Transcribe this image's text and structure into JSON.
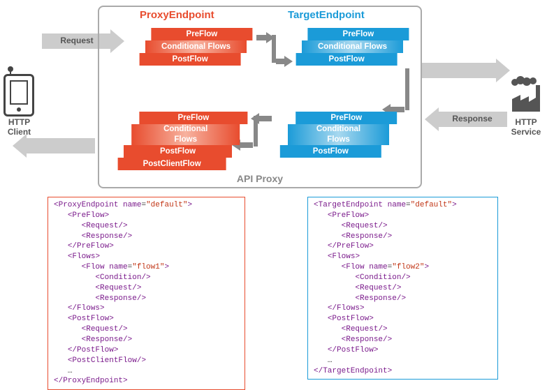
{
  "client_label": "HTTP\nClient",
  "service_label": "HTTP\nService",
  "api_proxy_label": "API Proxy",
  "request_label": "Request",
  "response_label": "Response",
  "titles": {
    "proxy": "ProxyEndpoint",
    "target": "TargetEndpoint"
  },
  "flow_labels": {
    "pre": "PreFlow",
    "cond": "Conditional Flows",
    "cond2a": "Conditional",
    "cond2b": "Flows",
    "post": "PostFlow",
    "postclient": "PostClientFlow"
  },
  "code_proxy": {
    "open": "ProxyEndpoint",
    "name_attr": "name",
    "name_val": "default",
    "pre": "PreFlow",
    "req": "Request",
    "res": "Response",
    "flows": "Flows",
    "flow": "Flow",
    "flow_name": "flow1",
    "cond": "Condition",
    "post": "PostFlow",
    "pcf": "PostClientFlow",
    "ellipsis": "…"
  },
  "code_target": {
    "open": "TargetEndpoint",
    "name_attr": "name",
    "name_val": "default",
    "pre": "PreFlow",
    "req": "Request",
    "res": "Response",
    "flows": "Flows",
    "flow": "Flow",
    "flow_name": "flow2",
    "cond": "Condition",
    "post": "PostFlow",
    "ellipsis": "…"
  }
}
